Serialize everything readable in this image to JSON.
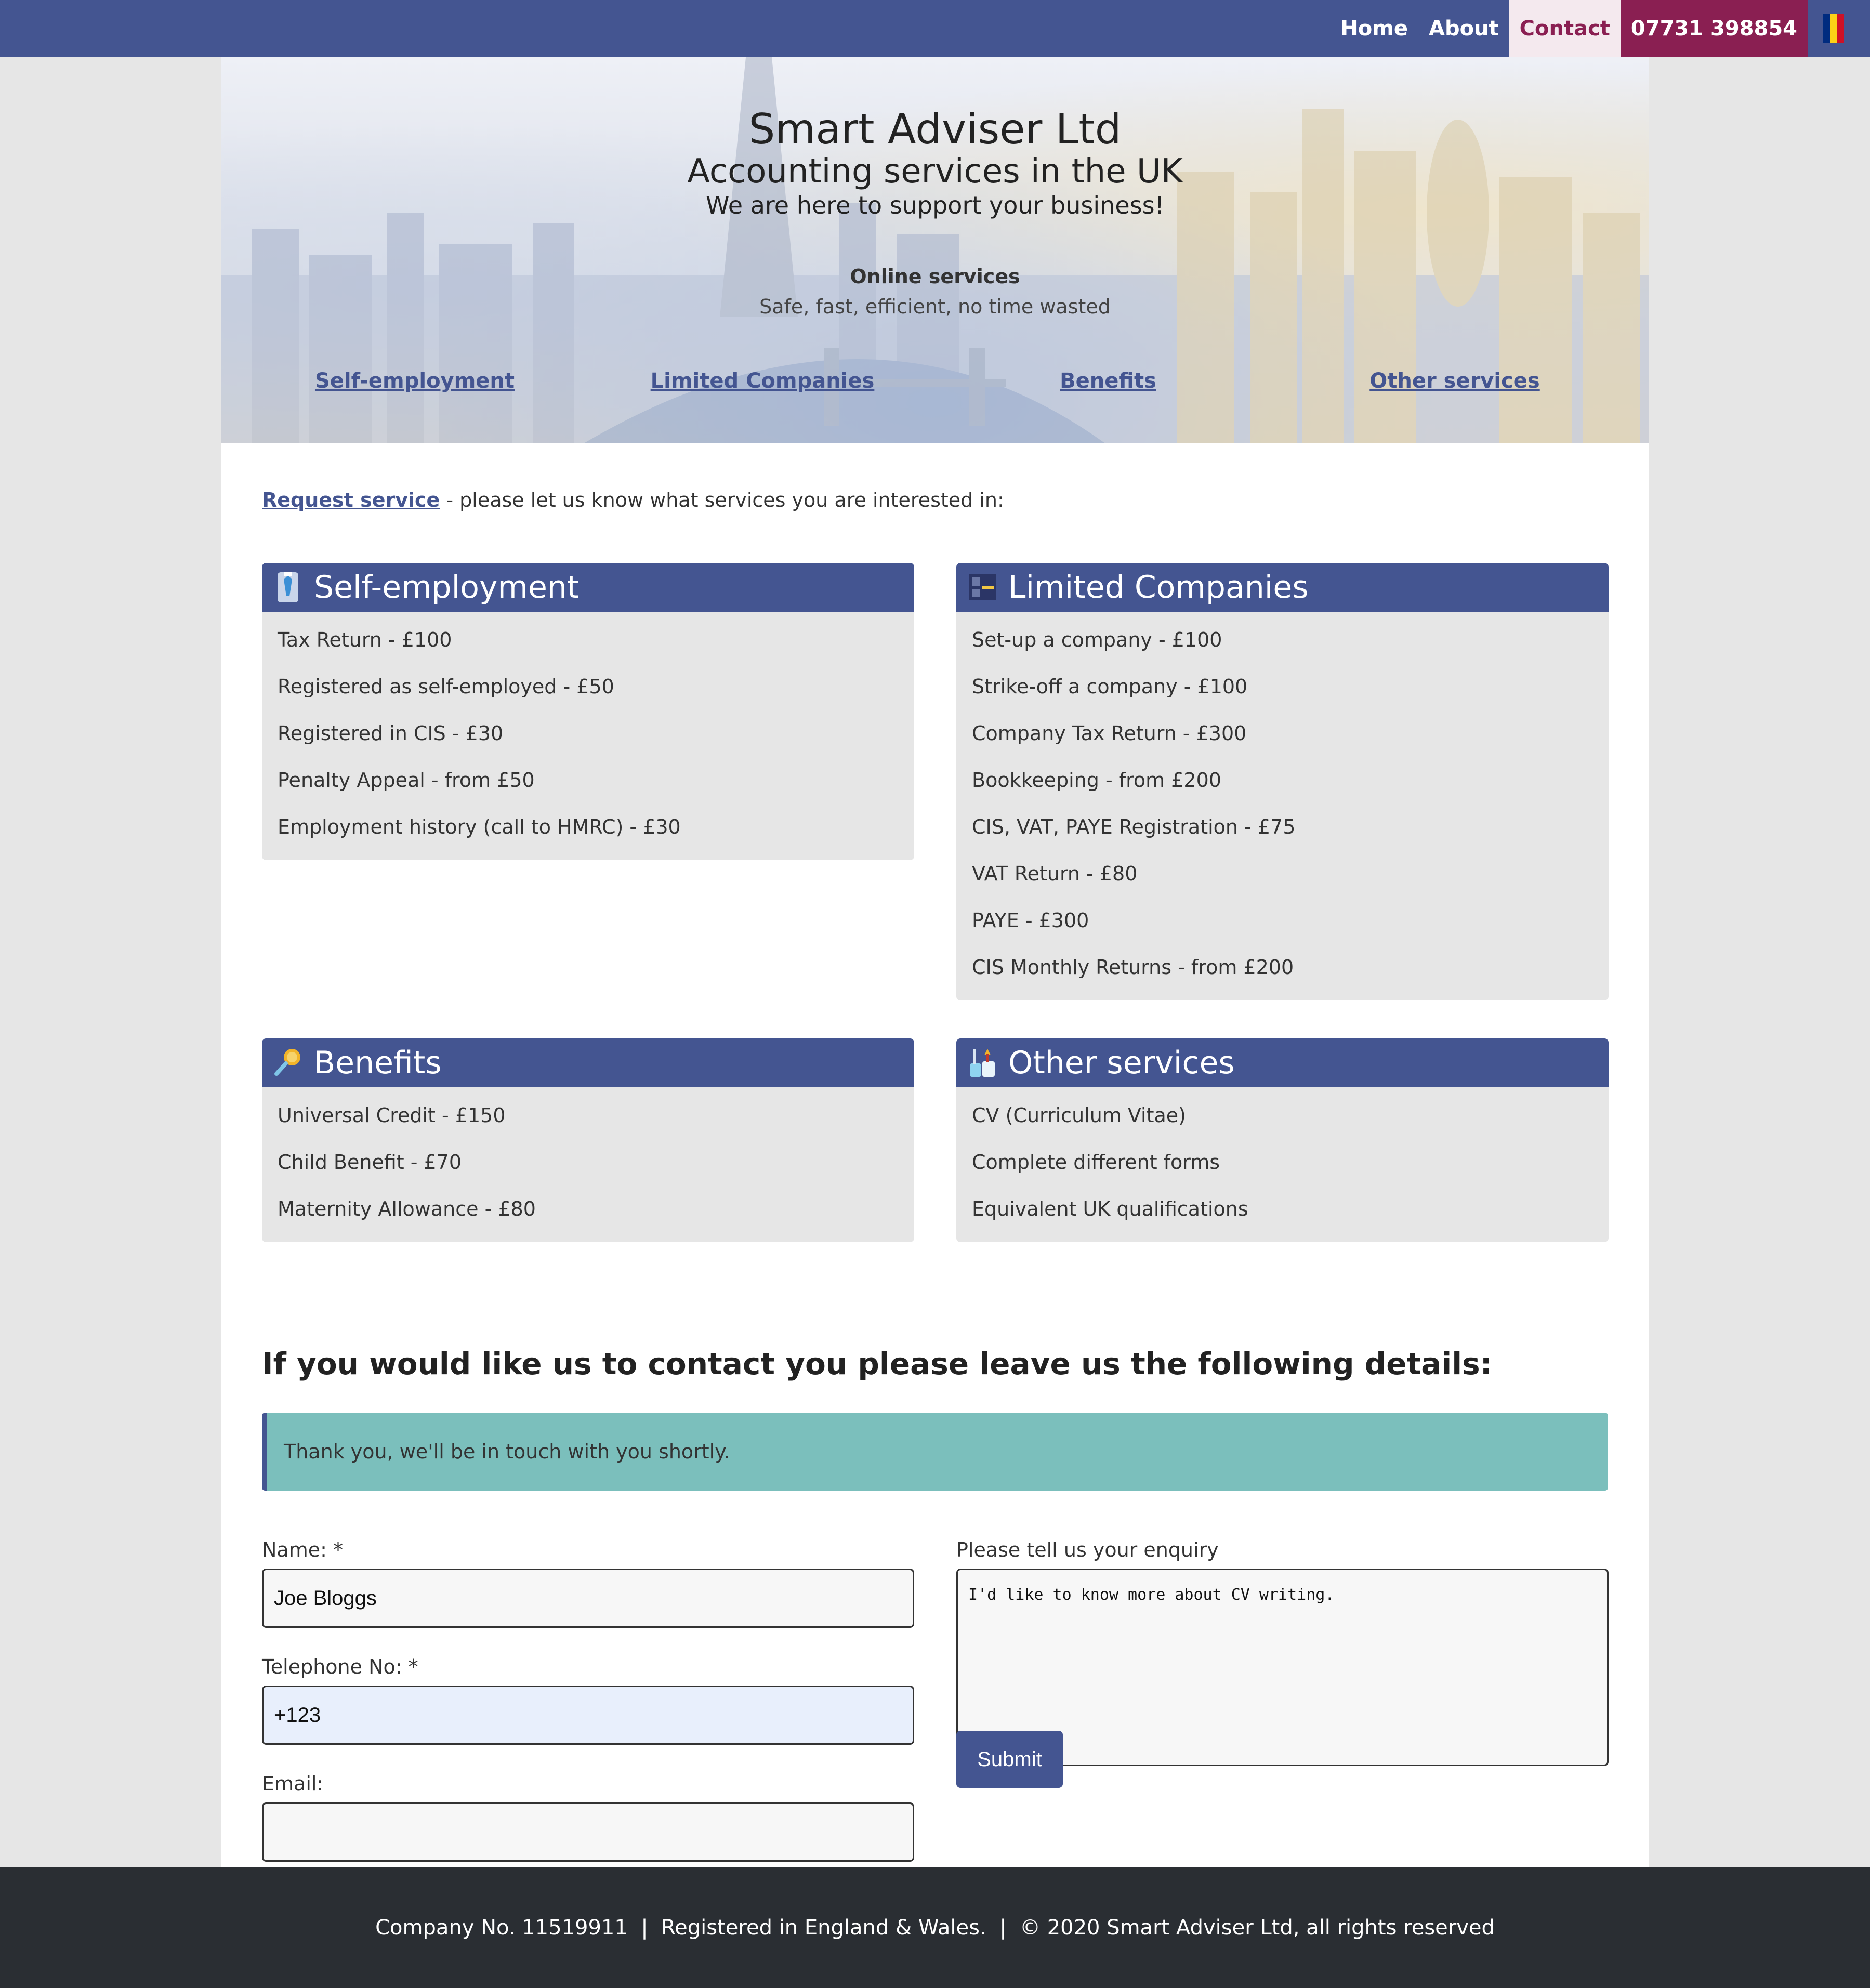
{
  "nav": {
    "items": [
      {
        "label": "Home"
      },
      {
        "label": "About"
      },
      {
        "label": "Contact"
      }
    ],
    "phone": "07731 398854",
    "flag_colors": [
      "#002b7f",
      "#fcd116",
      "#ce1126"
    ]
  },
  "hero": {
    "title": "Smart Adviser Ltd",
    "subtitle": "Accounting services in the UK",
    "tagline": "We are here to support your business!",
    "online_title": "Online services",
    "online_sub": "Safe, fast, efficient, no time wasted",
    "links": [
      "Self-employment",
      "Limited Companies",
      "Benefits",
      "Other services"
    ]
  },
  "request": {
    "link": "Request service",
    "text": " - please let us know what services you are interested in:"
  },
  "cards": [
    {
      "title": "Self-employment",
      "icon": "tie-icon",
      "items": [
        "Tax Return - £100",
        "Registered as self-employed - £50",
        "Registered in CIS - £30",
        "Penalty Appeal - from £50",
        "Employment history (call to HMRC) - £30"
      ]
    },
    {
      "title": "Limited Companies",
      "icon": "office-icon",
      "items": [
        "Set-up a company - £100",
        "Strike-off a company - £100",
        "Company Tax Return - £300",
        "Bookkeeping - from £200",
        "CIS, VAT, PAYE Registration - £75",
        "VAT Return - £80",
        "PAYE - £300",
        "CIS Monthly Returns - from £200"
      ]
    },
    {
      "title": "Benefits",
      "icon": "magnifier-icon",
      "items": [
        "Universal Credit - £150",
        "Child Benefit - £70",
        "Maternity Allowance - £80"
      ]
    },
    {
      "title": "Other services",
      "icon": "tools-icon",
      "items": [
        "CV (Curriculum Vitae)",
        "Complete different forms",
        "Equivalent UK qualifications"
      ]
    }
  ],
  "contact": {
    "title": "If you would like us to contact you please leave us the following details:",
    "alert": "Thank you, we'll be in touch with you shortly.",
    "name_label": "Name: *",
    "name_value": "Joe Bloggs",
    "phone_label": "Telephone No: *",
    "phone_value": "+123",
    "email_label": "Email:",
    "email_value": "",
    "enquiry_label": "Please tell us your enquiry",
    "enquiry_value": "I'd like to know more about CV writing.",
    "submit": "Submit"
  },
  "footer": {
    "text": "Company No. 11519911  |  Registered in England & Wales.  |  © 2020 Smart Adviser Ltd, all rights reserved"
  },
  "colors": {
    "primary": "#445591",
    "accent": "#8a1f52",
    "alert": "#7bbfbc",
    "footer": "#2a2e33"
  }
}
